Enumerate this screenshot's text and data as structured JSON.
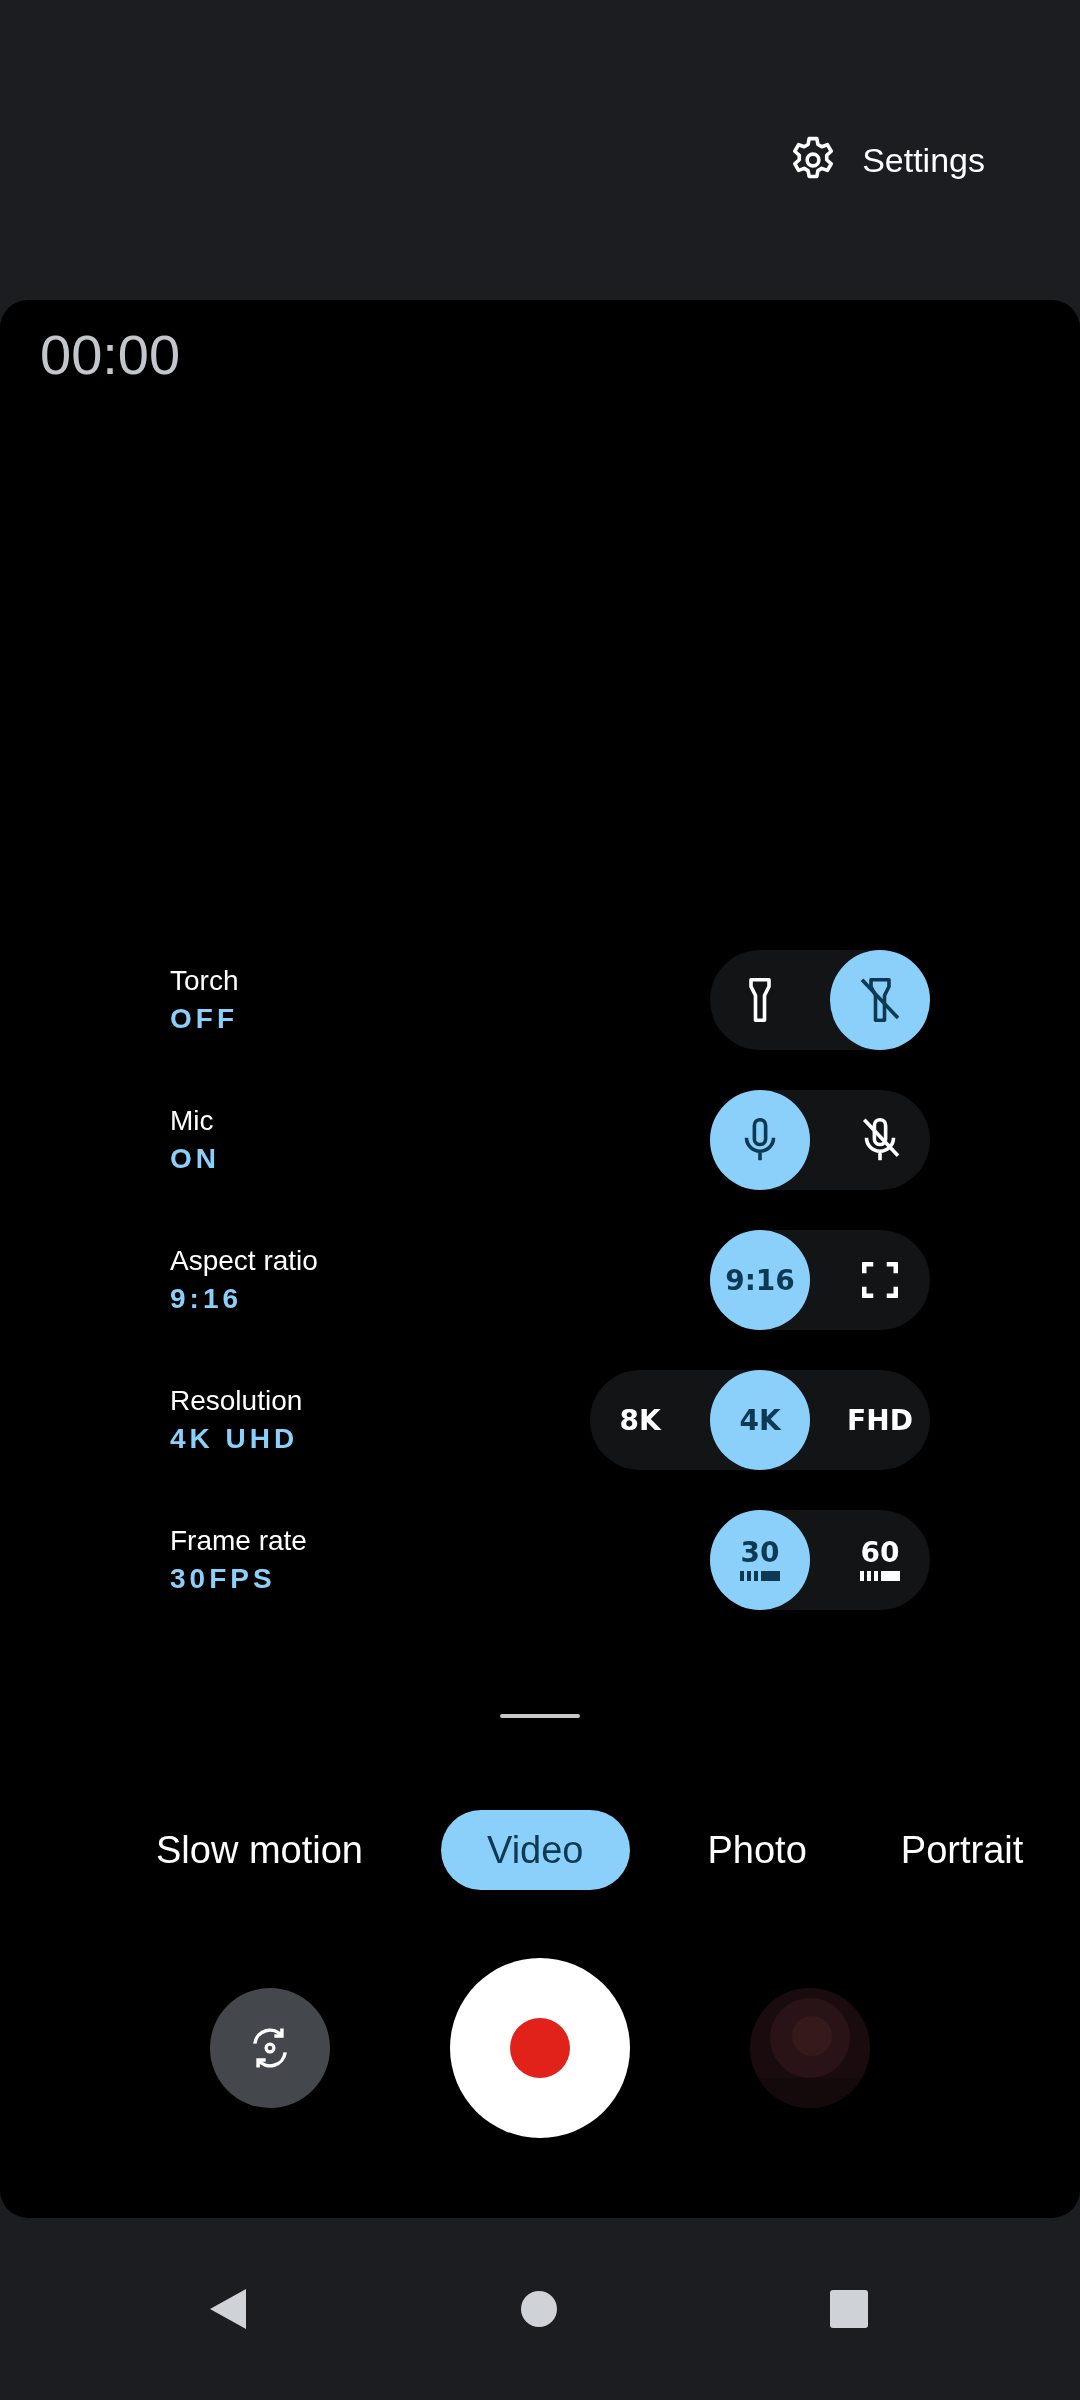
{
  "top_bar": {
    "settings_label": "Settings"
  },
  "timer": "00:00",
  "quick_settings": [
    {
      "label": "Torch",
      "value": "OFF",
      "options": [
        {
          "kind": "torch",
          "selected": false
        },
        {
          "kind": "torch-off",
          "selected": true
        }
      ]
    },
    {
      "label": "Mic",
      "value": "ON",
      "options": [
        {
          "kind": "mic",
          "selected": true
        },
        {
          "kind": "mic-off",
          "selected": false
        }
      ]
    },
    {
      "label": "Aspect ratio",
      "value": "9:16",
      "options": [
        {
          "kind": "text",
          "text": "9:16",
          "selected": true
        },
        {
          "kind": "full-frame",
          "selected": false
        }
      ]
    },
    {
      "label": "Resolution",
      "value": "4K UHD",
      "options": [
        {
          "kind": "text",
          "text": "8K",
          "selected": false
        },
        {
          "kind": "text",
          "text": "4K",
          "selected": true
        },
        {
          "kind": "text",
          "text": "FHD",
          "selected": false
        }
      ]
    },
    {
      "label": "Frame rate",
      "value": "30FPS",
      "options": [
        {
          "kind": "fps",
          "text": "30",
          "selected": true
        },
        {
          "kind": "fps",
          "text": "60",
          "selected": false
        }
      ]
    }
  ],
  "modes": [
    {
      "label": "Slow motion",
      "selected": false
    },
    {
      "label": "Video",
      "selected": true
    },
    {
      "label": "Photo",
      "selected": false
    },
    {
      "label": "Portrait",
      "selected": false
    }
  ]
}
